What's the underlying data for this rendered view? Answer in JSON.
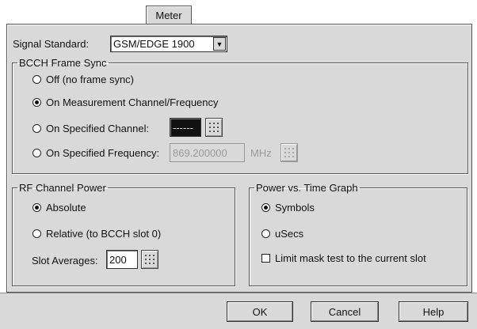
{
  "tab": {
    "label": "Meter"
  },
  "signal_standard": {
    "label": "Signal Standard:",
    "value": "GSM/EDGE 1900"
  },
  "bcch": {
    "title": "BCCH Frame Sync",
    "off": "Off (no frame sync)",
    "on_measurement": "On Measurement Channel/Frequency",
    "on_channel": "On Specified Channel:",
    "channel_value": "------",
    "on_frequency": "On Specified Frequency:",
    "frequency_value": "869.200000",
    "frequency_unit": "MHz",
    "selected": "on_measurement"
  },
  "rf": {
    "title": "RF Channel Power",
    "absolute": "Absolute",
    "relative": "Relative (to BCCH slot 0)",
    "slot_label": "Slot Averages:",
    "slot_value": "200",
    "selected": "absolute"
  },
  "pvt": {
    "title": "Power vs. Time Graph",
    "symbols": "Symbols",
    "usecs": "uSecs",
    "limit_mask": "Limit mask test to the current slot",
    "limit_mask_checked": false,
    "selected": "symbols"
  },
  "buttons": {
    "ok": "OK",
    "cancel": "Cancel",
    "help": "Help"
  },
  "icons": {
    "keypad": "keypad-icon",
    "dropdown": "chevron-down-icon"
  }
}
